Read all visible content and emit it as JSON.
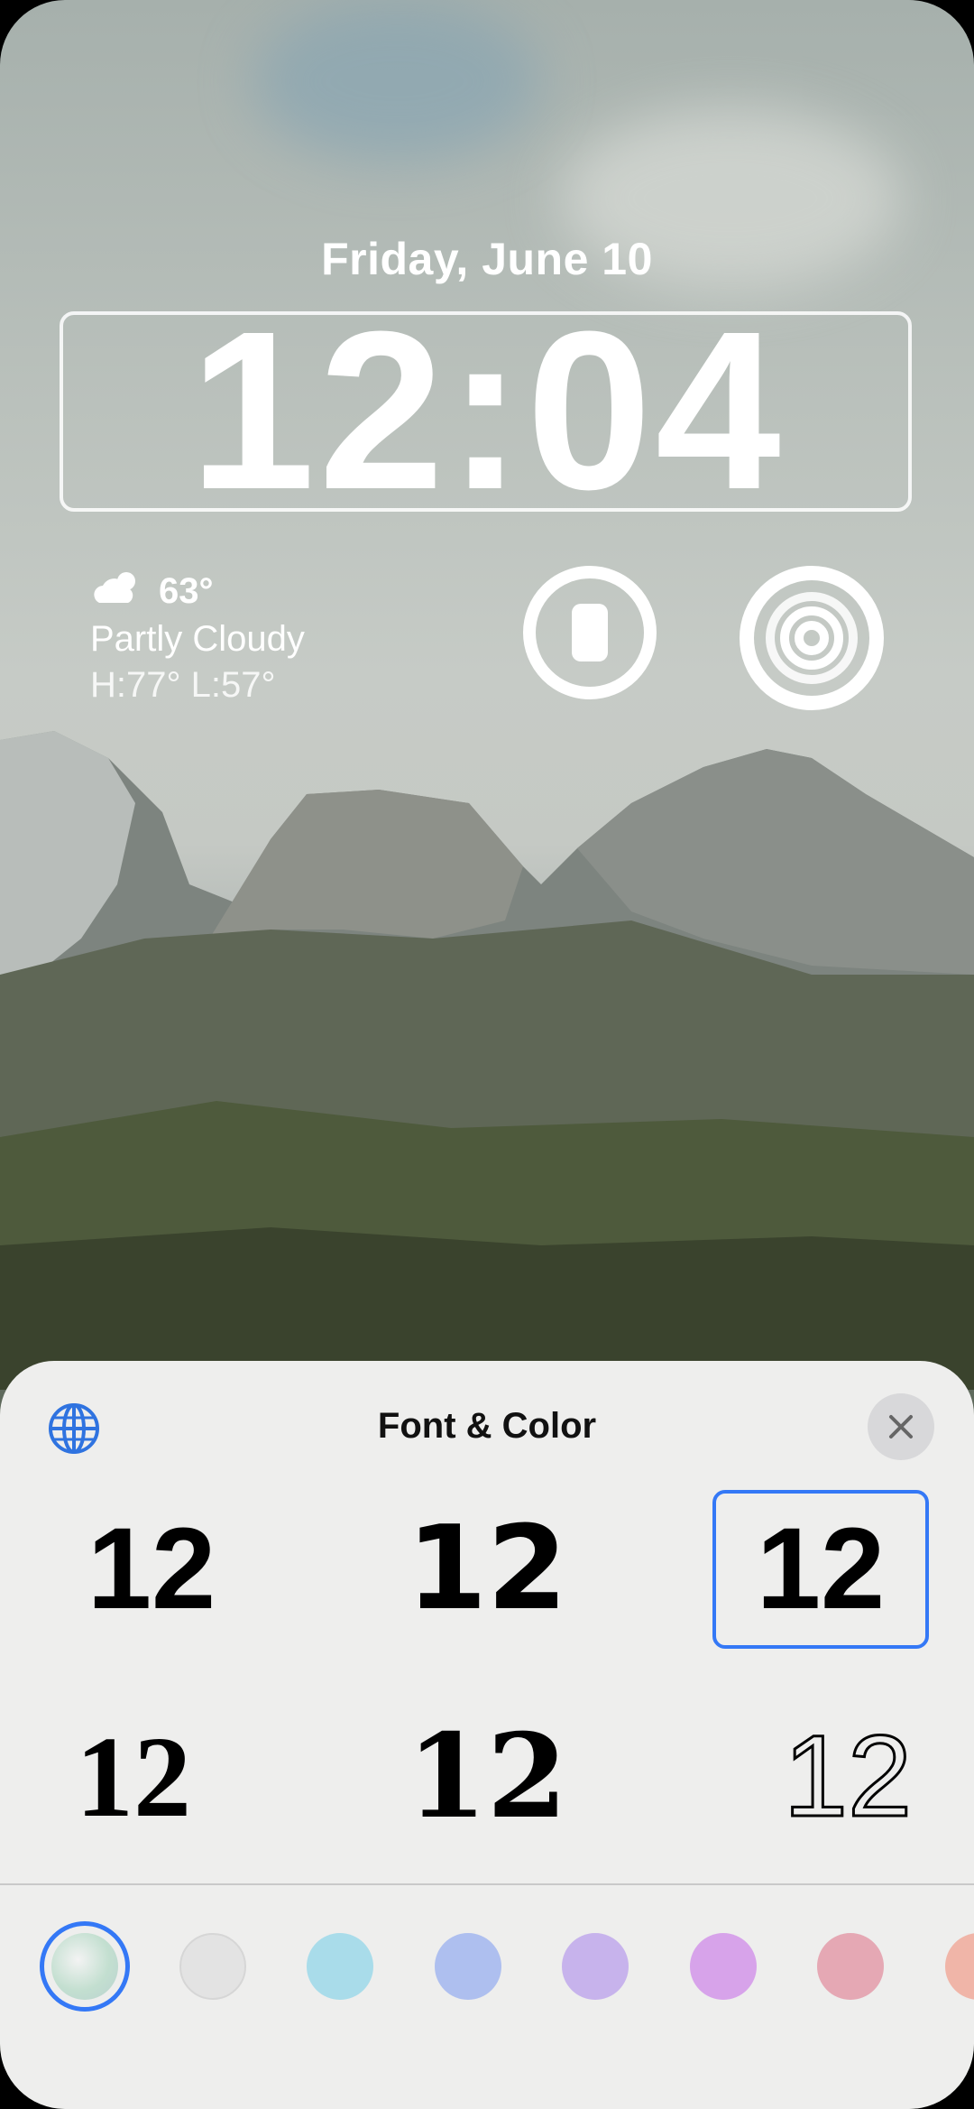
{
  "lock_screen": {
    "date": "Friday, June 10",
    "time": "12:04",
    "weather": {
      "temperature": "63°",
      "condition": "Partly Cloudy",
      "high_low": "H:77° L:57°",
      "icon": "partly-cloudy-icon"
    },
    "widgets": [
      {
        "name": "watch-battery-widget",
        "icon": "apple-watch-icon"
      },
      {
        "name": "activity-rings-widget",
        "icon": "activity-rings-icon"
      }
    ]
  },
  "sheet": {
    "title": "Font & Color",
    "globe_icon": "globe-icon",
    "close_icon": "close-icon",
    "font_options": [
      {
        "label": "12",
        "style": "rounded-bold",
        "selected": false
      },
      {
        "label": "12",
        "style": "sans-bold",
        "selected": false
      },
      {
        "label": "12",
        "style": "stencil",
        "selected": true
      },
      {
        "label": "12",
        "style": "serif-bold",
        "selected": false
      },
      {
        "label": "12",
        "style": "slab-bold",
        "selected": false
      },
      {
        "label": "12",
        "style": "outline",
        "selected": false
      }
    ],
    "colors": [
      "#c9dfcf",
      "#e4e4e4",
      "#a9dcea",
      "#aebfef",
      "#c7b3ec",
      "#d7a3ea",
      "#e5a8b4",
      "#f0b5a8"
    ],
    "accent": "#3478f6"
  }
}
